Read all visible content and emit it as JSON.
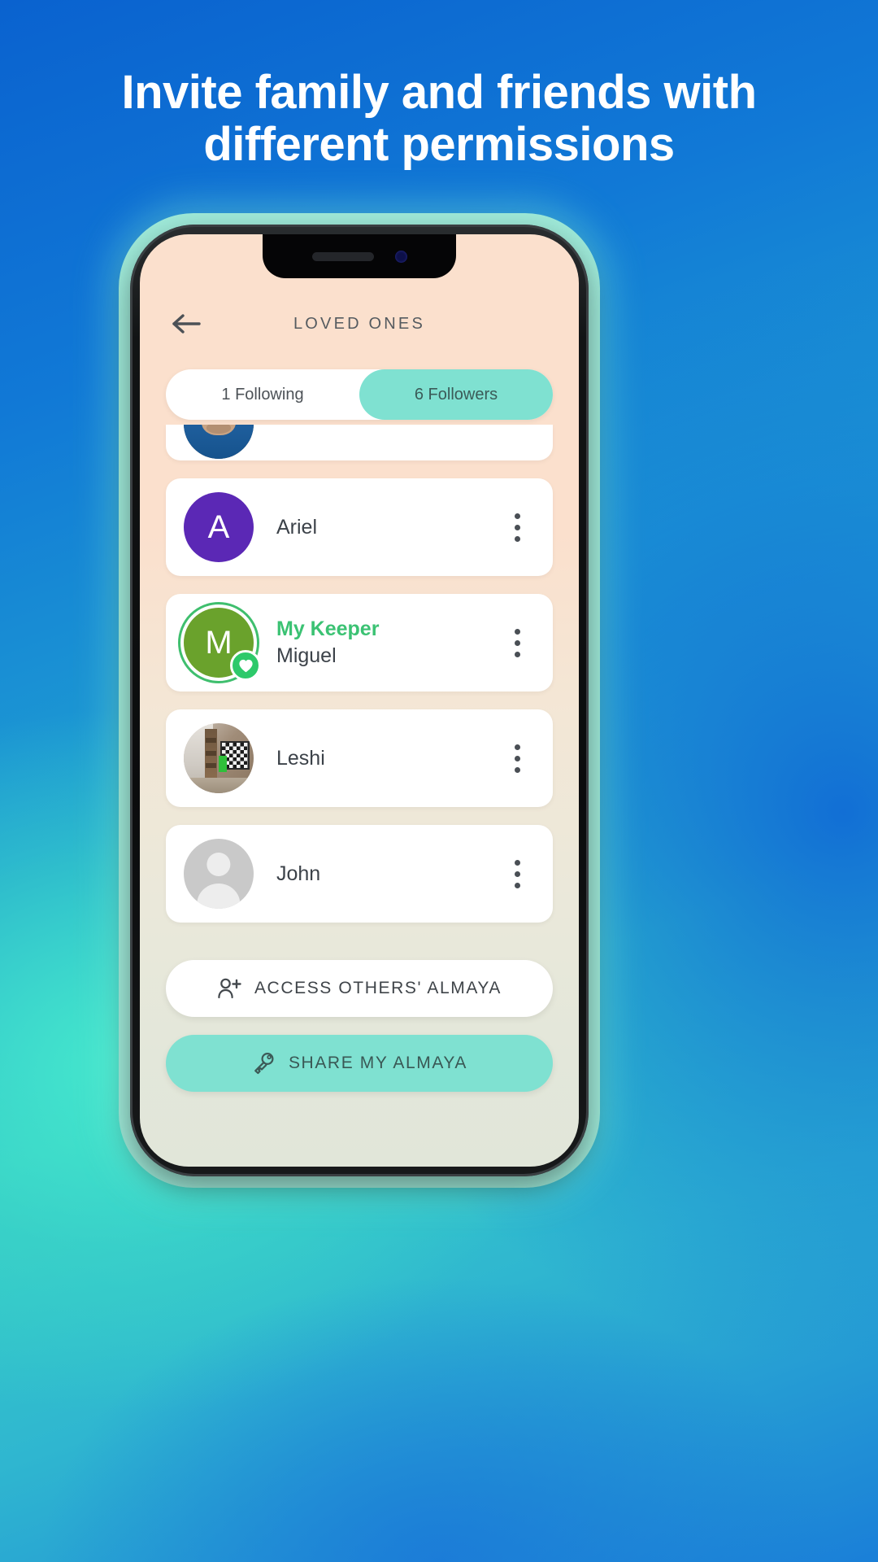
{
  "promo": {
    "headline_line1": "Invite family and friends with",
    "headline_line2": "different permissions"
  },
  "colors": {
    "bg_blue": "#0a62cf",
    "bg_teal": "#36cfc6",
    "phone_frame": "#9fead9",
    "header_peach": "#fbe0cd",
    "screen_bottom": "#e1e6d9",
    "accent_teal": "#7fe1d1",
    "keeper_green": "#3bc273",
    "avatar_purple": "#5b28b5",
    "avatar_olive": "#6aa22c",
    "text_dark": "#3c4249",
    "text_muted": "#555b60"
  },
  "app": {
    "header": {
      "back_icon": "arrow-left-icon",
      "title": "LOVED ONES"
    },
    "tabs": [
      {
        "label": "1 Following",
        "active": false
      },
      {
        "label": "6 Followers",
        "active": true
      }
    ],
    "people": [
      {
        "name": "",
        "avatar_type": "photo-person",
        "clipped": true,
        "keeper_tag": "",
        "menu_icon": "kebab-menu-icon"
      },
      {
        "name": "Ariel",
        "avatar_type": "initial",
        "initial": "A",
        "avatar_color": "#5b28b5",
        "keeper_tag": "",
        "menu_icon": "kebab-menu-icon"
      },
      {
        "name": "Miguel",
        "avatar_type": "initial",
        "initial": "M",
        "avatar_color": "#6aa22c",
        "keeper_tag": "My Keeper",
        "badge_icon": "heart-icon",
        "menu_icon": "kebab-menu-icon"
      },
      {
        "name": "Leshi",
        "avatar_type": "photo-room",
        "keeper_tag": "",
        "menu_icon": "kebab-menu-icon"
      },
      {
        "name": "John",
        "avatar_type": "placeholder",
        "keeper_tag": "",
        "menu_icon": "kebab-menu-icon"
      }
    ],
    "actions": {
      "access_others": {
        "label": "ACCESS OTHERS' ALMAYA",
        "icon": "person-plus-icon"
      },
      "share_mine": {
        "label": "SHARE MY ALMAYA",
        "icon": "key-icon"
      }
    }
  }
}
